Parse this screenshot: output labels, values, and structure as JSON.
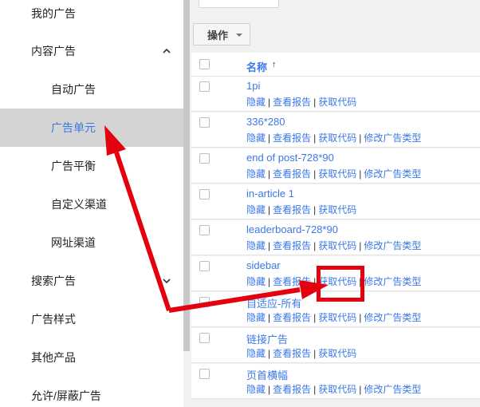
{
  "sidebar": {
    "items": [
      {
        "label": "我的广告",
        "level": "top"
      },
      {
        "label": "内容广告",
        "level": "top",
        "expanded": true
      },
      {
        "label": "自动广告",
        "level": "sub"
      },
      {
        "label": "广告单元",
        "level": "sub",
        "active": true
      },
      {
        "label": "广告平衡",
        "level": "sub"
      },
      {
        "label": "自定义渠道",
        "level": "sub"
      },
      {
        "label": "网址渠道",
        "level": "sub"
      },
      {
        "label": "搜索广告",
        "level": "top",
        "expanded": false
      },
      {
        "label": "广告样式",
        "level": "top"
      },
      {
        "label": "其他产品",
        "level": "top"
      },
      {
        "label": "允许/屏蔽广告",
        "level": "top"
      }
    ]
  },
  "toolbar": {
    "ops_label": "操作"
  },
  "table": {
    "header": {
      "name_label": "名称",
      "sort_arrow": "↑"
    },
    "actions": {
      "hide": "隐藏",
      "report": "查看报告",
      "code": "获取代码",
      "change_type": "修改广告类型",
      "separator": "|"
    },
    "rows": [
      {
        "name": "1pi",
        "change_type": false
      },
      {
        "name": "336*280",
        "change_type": true
      },
      {
        "name": "end of post-728*90",
        "change_type": true
      },
      {
        "name": "in-article 1",
        "change_type": false
      },
      {
        "name": "leaderboard-728*90",
        "change_type": true
      },
      {
        "name": "sidebar",
        "change_type": true
      },
      {
        "name": "自适应-所有",
        "change_type": true
      },
      {
        "name": "链接广告",
        "change_type": false
      },
      {
        "name": "页首横幅",
        "change_type": true
      }
    ]
  },
  "colors": {
    "link": "#3b78e7",
    "annotation": "#e3000f",
    "active_bg": "#d4d4d4"
  }
}
